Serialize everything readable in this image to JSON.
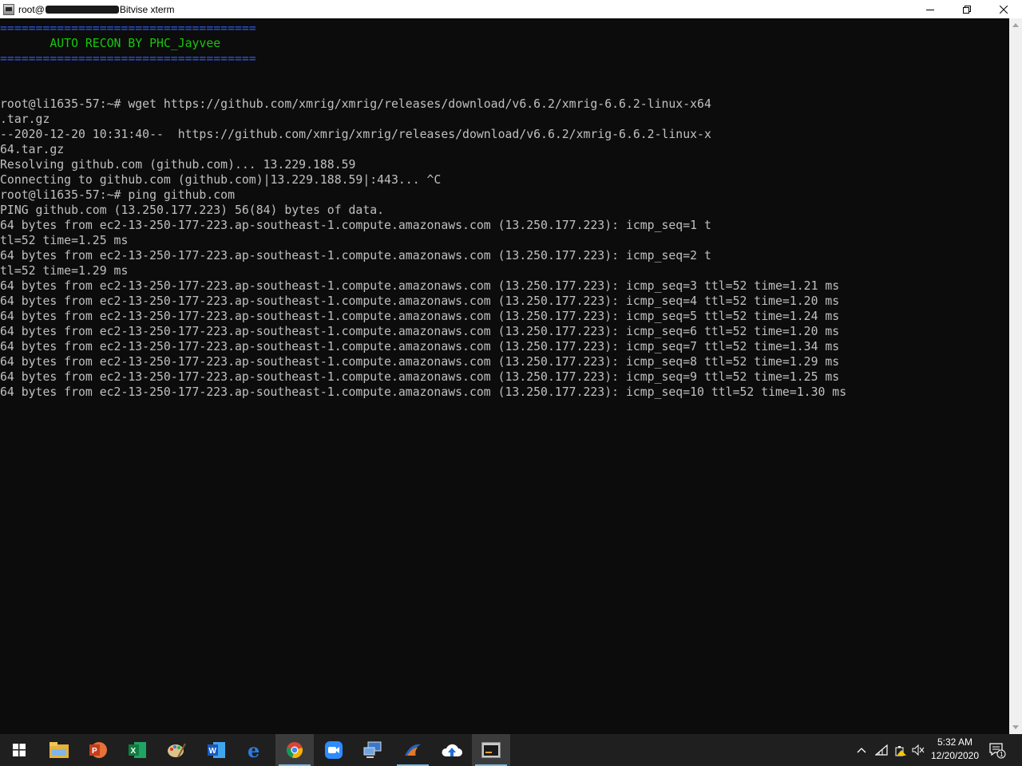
{
  "window": {
    "title_prefix": "root@",
    "title_suffix": "Bitvise xterm"
  },
  "terminal": {
    "lines": [
      {
        "text": "====================================",
        "color": "blue"
      },
      {
        "text": "       AUTO RECON BY PHC_Jayvee",
        "color": "green"
      },
      {
        "text": "====================================",
        "color": "blue"
      },
      {
        "text": "",
        "color": "gray"
      },
      {
        "text": "",
        "color": "gray"
      },
      {
        "text": "root@li1635-57:~# wget https://github.com/xmrig/xmrig/releases/download/v6.6.2/xmrig-6.6.2-linux-x64",
        "color": "gray"
      },
      {
        "text": ".tar.gz",
        "color": "gray"
      },
      {
        "text": "--2020-12-20 10:31:40--  https://github.com/xmrig/xmrig/releases/download/v6.6.2/xmrig-6.6.2-linux-x",
        "color": "gray"
      },
      {
        "text": "64.tar.gz",
        "color": "gray"
      },
      {
        "text": "Resolving github.com (github.com)... 13.229.188.59",
        "color": "gray"
      },
      {
        "text": "Connecting to github.com (github.com)|13.229.188.59|:443... ^C",
        "color": "gray"
      },
      {
        "text": "root@li1635-57:~# ping github.com",
        "color": "gray"
      },
      {
        "text": "PING github.com (13.250.177.223) 56(84) bytes of data.",
        "color": "gray"
      },
      {
        "text": "64 bytes from ec2-13-250-177-223.ap-southeast-1.compute.amazonaws.com (13.250.177.223): icmp_seq=1 t",
        "color": "gray"
      },
      {
        "text": "tl=52 time=1.25 ms",
        "color": "gray"
      },
      {
        "text": "64 bytes from ec2-13-250-177-223.ap-southeast-1.compute.amazonaws.com (13.250.177.223): icmp_seq=2 t",
        "color": "gray"
      },
      {
        "text": "tl=52 time=1.29 ms",
        "color": "gray"
      },
      {
        "text": "64 bytes from ec2-13-250-177-223.ap-southeast-1.compute.amazonaws.com (13.250.177.223): icmp_seq=3 ttl=52 time=1.21 ms",
        "color": "gray"
      },
      {
        "text": "64 bytes from ec2-13-250-177-223.ap-southeast-1.compute.amazonaws.com (13.250.177.223): icmp_seq=4 ttl=52 time=1.20 ms",
        "color": "gray"
      },
      {
        "text": "64 bytes from ec2-13-250-177-223.ap-southeast-1.compute.amazonaws.com (13.250.177.223): icmp_seq=5 ttl=52 time=1.24 ms",
        "color": "gray"
      },
      {
        "text": "64 bytes from ec2-13-250-177-223.ap-southeast-1.compute.amazonaws.com (13.250.177.223): icmp_seq=6 ttl=52 time=1.20 ms",
        "color": "gray"
      },
      {
        "text": "64 bytes from ec2-13-250-177-223.ap-southeast-1.compute.amazonaws.com (13.250.177.223): icmp_seq=7 ttl=52 time=1.34 ms",
        "color": "gray"
      },
      {
        "text": "64 bytes from ec2-13-250-177-223.ap-southeast-1.compute.amazonaws.com (13.250.177.223): icmp_seq=8 ttl=52 time=1.29 ms",
        "color": "gray"
      },
      {
        "text": "64 bytes from ec2-13-250-177-223.ap-southeast-1.compute.amazonaws.com (13.250.177.223): icmp_seq=9 ttl=52 time=1.25 ms",
        "color": "gray"
      },
      {
        "text": "64 bytes from ec2-13-250-177-223.ap-southeast-1.compute.amazonaws.com (13.250.177.223): icmp_seq=10 ttl=52 time=1.30 ms",
        "color": "gray"
      }
    ]
  },
  "taskbar": {
    "apps": [
      "start-icon",
      "file-explorer-icon",
      "powerpoint-icon",
      "excel-icon",
      "paint-icon",
      "word-icon",
      "edge-icon",
      "chrome-icon",
      "zoom-icon",
      "remote-desktop-icon",
      "wireshark-icon",
      "cloud-app-icon",
      "bitvise-xterm-icon"
    ],
    "clock_time": "5:32 AM",
    "clock_date": "12/20/2020",
    "notification_count": "1"
  },
  "colors": {
    "terminal_bg": "#0c0c0c",
    "terminal_fg": "#c0c0c0",
    "banner_blue": "#2c5cff",
    "banner_green": "#16c60c",
    "taskbar_bg": "#1f1f1f"
  }
}
